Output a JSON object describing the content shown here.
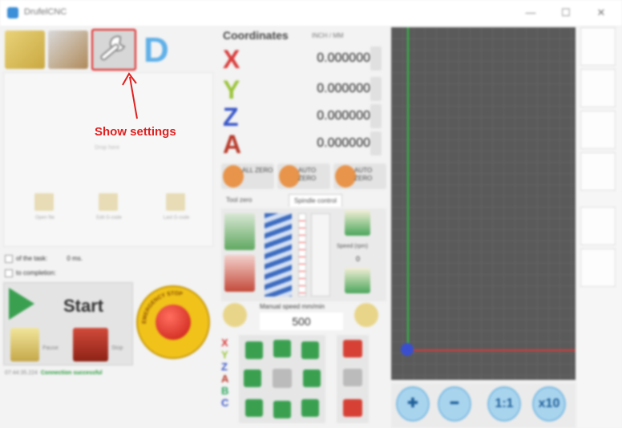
{
  "window": {
    "title": "DrufelCNC",
    "controls": {
      "minimize": "—",
      "maximize": "☐",
      "close": "✕"
    }
  },
  "toolbar": {
    "buttons": [
      {
        "name": "open-file",
        "icon": "folder-icon"
      },
      {
        "name": "edit-file",
        "icon": "pencil-icon"
      },
      {
        "name": "settings",
        "icon": "wrench-icon"
      },
      {
        "name": "designer",
        "icon": "d-logo-icon",
        "glyph": "D"
      }
    ]
  },
  "file_panel": {
    "drop_hint": "Drop here",
    "actions": [
      "Open file",
      "Edit G-code",
      "Last G-code"
    ]
  },
  "status": {
    "time_of_task_label": "of the task:",
    "time_of_task_value": "0 ms.",
    "to_completion_label": "to completion:"
  },
  "run": {
    "start_label": "Start",
    "pause_label": "Pause",
    "stop_label": "Stop",
    "estop_text": "EMERGENCY STOP"
  },
  "log": {
    "time": "07:44:35.224",
    "message": "Connection successful"
  },
  "coordinates": {
    "title": "Coordinates",
    "subtitle": "INCH / MM",
    "axes": [
      {
        "letter": "X",
        "value": "0.000000",
        "color": "#d93b3b"
      },
      {
        "letter": "Y",
        "value": "0.000000",
        "color": "#9ac43a"
      },
      {
        "letter": "Z",
        "value": "0.000000",
        "color": "#3a57c8"
      },
      {
        "letter": "A",
        "value": "0.000000",
        "color": "#b83a2a"
      }
    ]
  },
  "zero": {
    "buttons": [
      "ALL ZERO",
      "AUTO ZERO",
      "AUTO ZERO"
    ]
  },
  "tabs": {
    "items": [
      "Tool zero",
      "Spindle control"
    ],
    "active": 1
  },
  "spindle": {
    "speed_label": "Speed (rpm)",
    "speed_value": "0"
  },
  "manual": {
    "label": "Manual speed mm/min",
    "value": "500"
  },
  "jog": {
    "letters": [
      {
        "t": "X",
        "c": "#d93b3b"
      },
      {
        "t": "Y",
        "c": "#9ac43a"
      },
      {
        "t": "Z",
        "c": "#3a57c8"
      },
      {
        "t": "A",
        "c": "#b83a2a"
      },
      {
        "t": "B",
        "c": "#2fa860"
      },
      {
        "t": "C",
        "c": "#3a57c8"
      }
    ]
  },
  "zoom": {
    "buttons": [
      "✚",
      "━",
      "1:1",
      "x10"
    ]
  },
  "annotation": {
    "label": "Show settings",
    "color": "#e02020"
  }
}
